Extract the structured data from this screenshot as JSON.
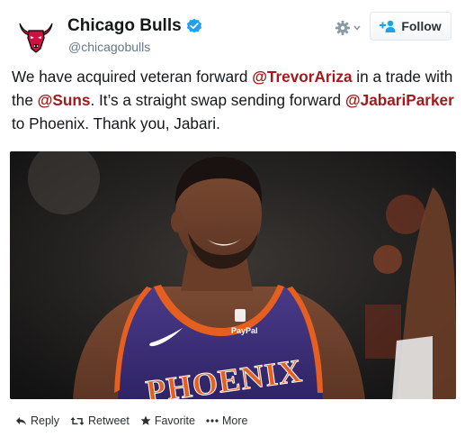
{
  "account": {
    "name": "Chicago Bulls",
    "handle": "@chicagobulls",
    "verified": true,
    "avatar_icon": "bulls-logo-icon",
    "brand_color": "#ce1141"
  },
  "header": {
    "follow_label": "Follow",
    "gear_icon": "gear-icon",
    "follow_icon": "add-user-icon"
  },
  "tweet": {
    "text_1": "We have acquired veteran forward ",
    "mention_1": "@TrevorAriza",
    "text_2": " in a trade with the ",
    "mention_2": "@Suns",
    "text_3": ". It’s a straight swap sending forward ",
    "mention_3": "@JabariParker",
    "text_4": " to Phoenix. Thank you, Jabari.",
    "mention_color": "#a7181b"
  },
  "media": {
    "jersey_text": "PHOENIX",
    "sponsor_text": "PayPal"
  },
  "actions": {
    "reply": "Reply",
    "retweet": "Retweet",
    "favorite": "Favorite",
    "more": "More"
  }
}
